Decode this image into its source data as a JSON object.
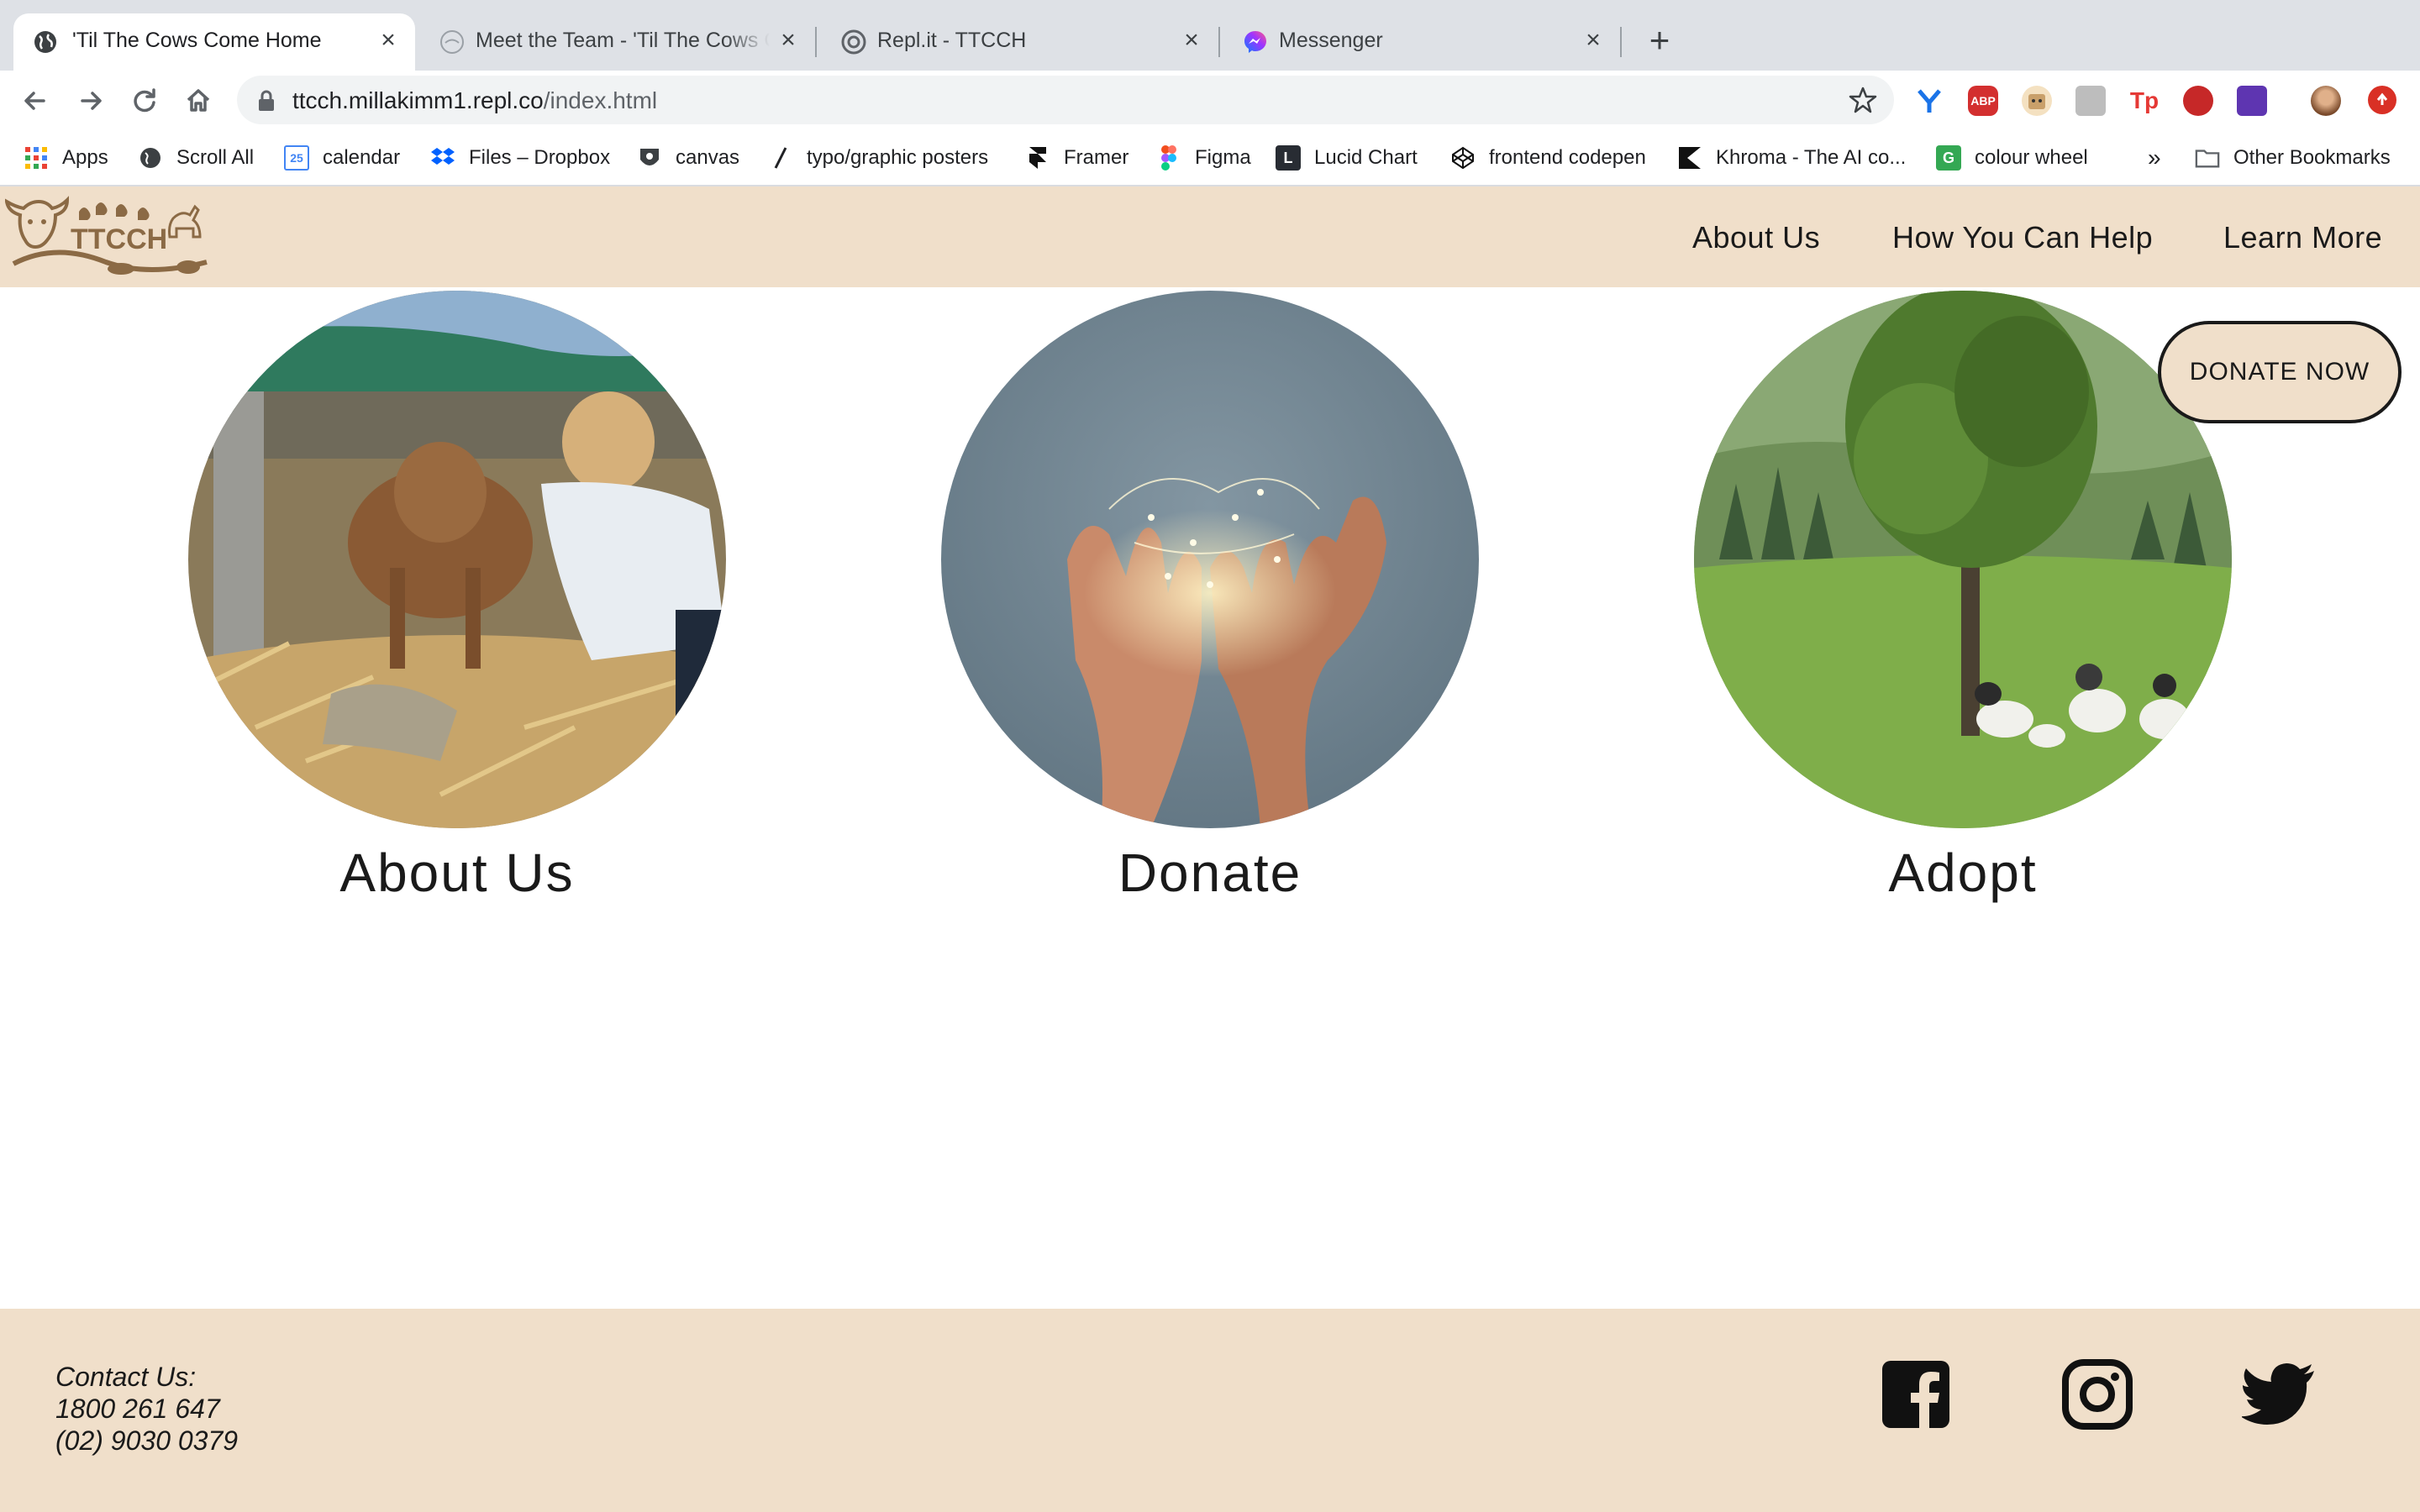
{
  "browser": {
    "tabs": [
      {
        "title": "'Til The Cows Come Home",
        "active": true,
        "favicon": "globe-icon"
      },
      {
        "title": "Meet the Team - 'Til The Cows Co",
        "active": false,
        "favicon": "cow-logo-icon"
      },
      {
        "title": "Repl.it - TTCCH",
        "active": false,
        "favicon": "replit-icon"
      },
      {
        "title": "Messenger",
        "active": false,
        "favicon": "messenger-icon"
      }
    ],
    "new_tab_label": "+",
    "url_host": "ttcch.millakimm1.repl.co",
    "url_path": "/index.html",
    "bookmarks": [
      {
        "label": "Apps",
        "icon": "apps-grid-icon"
      },
      {
        "label": "Scroll All",
        "icon": "globe-icon"
      },
      {
        "label": "calendar",
        "icon": "calendar-icon",
        "icon_text": "25"
      },
      {
        "label": "Files – Dropbox",
        "icon": "dropbox-icon"
      },
      {
        "label": "canvas",
        "icon": "canvas-icon"
      },
      {
        "label": "typo/graphic posters",
        "icon": "slash-icon"
      },
      {
        "label": "Framer",
        "icon": "framer-icon"
      },
      {
        "label": "Figma",
        "icon": "figma-icon"
      },
      {
        "label": "Lucid Chart",
        "icon": "lucidchart-icon"
      },
      {
        "label": "frontend codepen",
        "icon": "codepen-icon"
      },
      {
        "label": "Khroma - The AI co...",
        "icon": "khroma-icon"
      },
      {
        "label": "colour wheel",
        "icon": "colour-wheel-icon",
        "icon_text": "G"
      }
    ],
    "overflow_label": "»",
    "other_bookmarks": "Other Bookmarks",
    "extensions": {
      "abp": "ABP",
      "tp": "Tp"
    }
  },
  "site": {
    "logo_text": "TTCCH",
    "nav": [
      "About Us",
      "How You Can Help",
      "Learn More"
    ],
    "donate_button": "DONATE NOW",
    "cards": [
      {
        "title": "About Us",
        "image": "calf-with-volunteer-photo"
      },
      {
        "title": "Donate",
        "image": "hands-holding-fairy-lights-photo"
      },
      {
        "title": "Adopt",
        "image": "goats-under-tree-photo"
      }
    ],
    "footer": {
      "contact_heading": "Contact Us:",
      "phone_1": "1800 261 647",
      "phone_2": "(02) 9030 0379",
      "social": [
        "facebook-icon",
        "instagram-icon",
        "twitter-icon"
      ]
    }
  },
  "colors": {
    "brand_beige": "#f0dfca",
    "logo_brown": "#8b6a45",
    "tabstrip": "#dee1e6"
  }
}
